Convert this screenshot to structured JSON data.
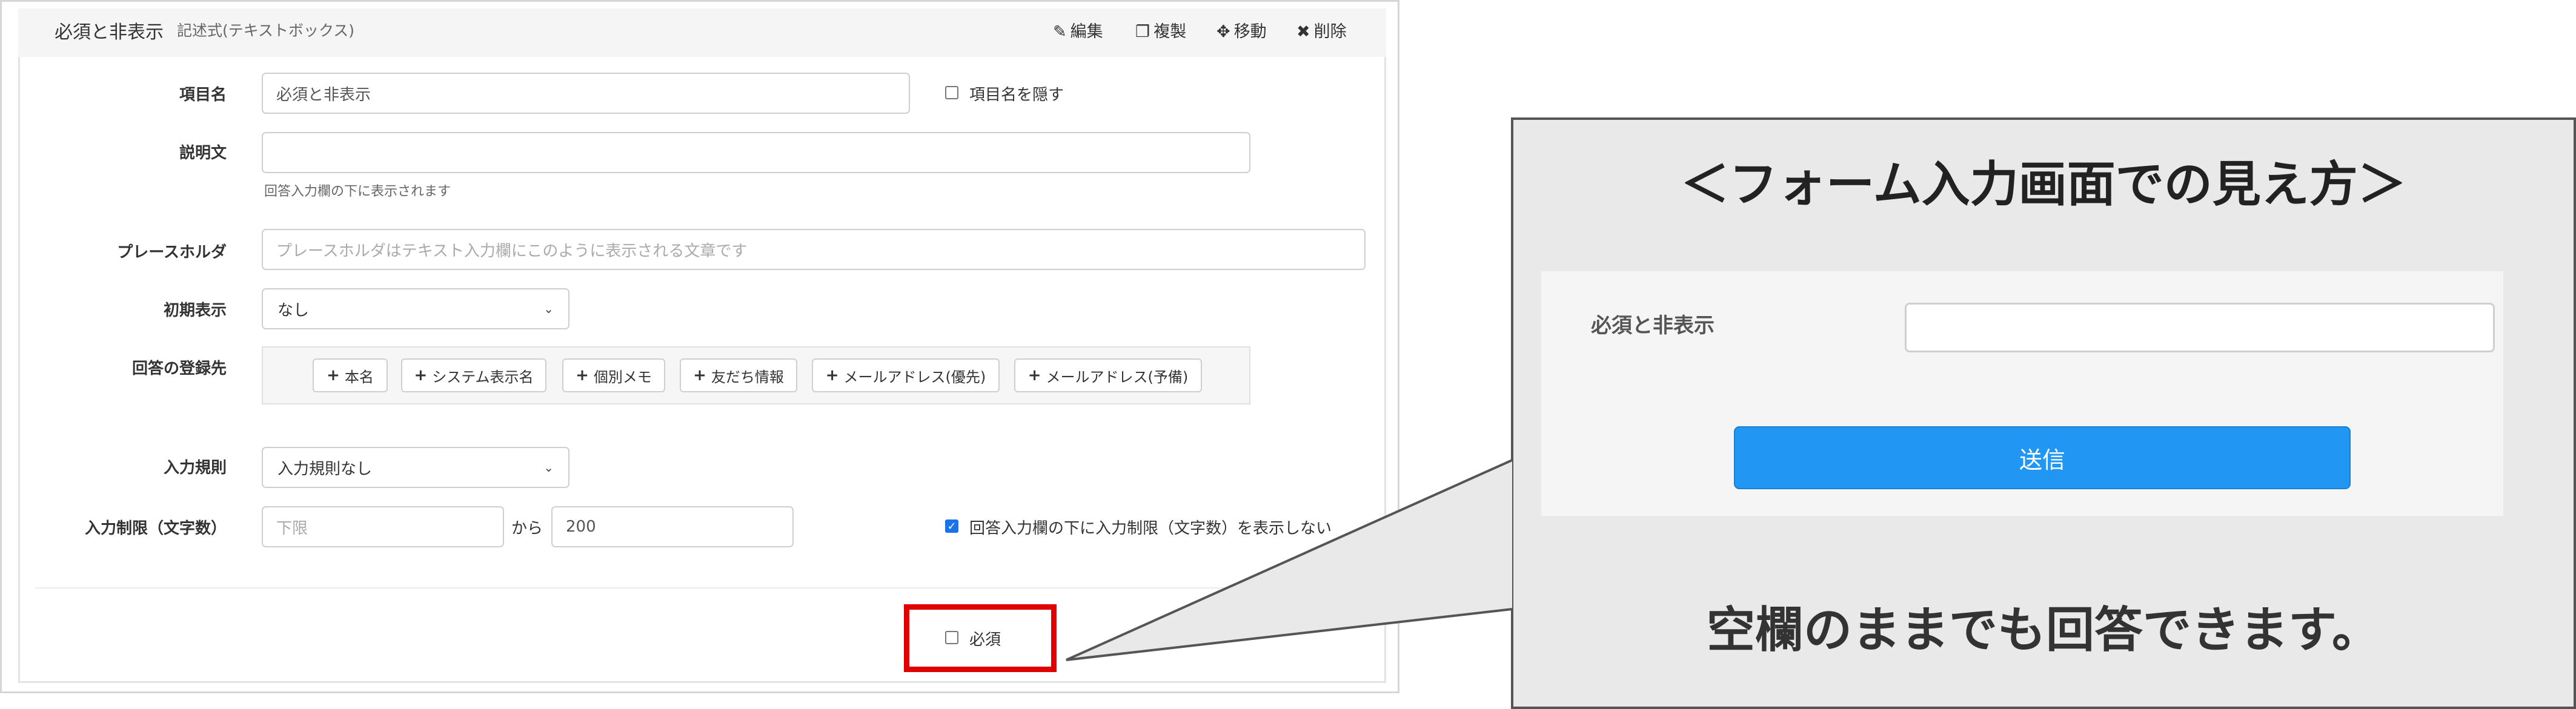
{
  "editor": {
    "header": {
      "title": "必須と非表示",
      "subtitle": "記述式(テキストボックス)",
      "actions": {
        "edit": "編集",
        "duplicate": "複製",
        "move": "移動",
        "delete": "削除"
      }
    },
    "fields": {
      "item_name": {
        "label": "項目名",
        "value": "必須と非表示",
        "hide_label": "項目名を隠す",
        "hide_checked": false
      },
      "description": {
        "label": "説明文",
        "value": "",
        "help": "回答入力欄の下に表示されます"
      },
      "placeholder": {
        "label": "プレースホルダ",
        "placeholder": "プレースホルダはテキスト入力欄にこのように表示される文章です"
      },
      "initial_display": {
        "label": "初期表示",
        "value": "なし"
      },
      "answer_destination": {
        "label": "回答の登録先",
        "buttons": [
          "本名",
          "システム表示名",
          "個別メモ",
          "友だち情報",
          "メールアドレス(優先)",
          "メールアドレス(予備)"
        ]
      },
      "input_rule": {
        "label": "入力規則",
        "value": "入力規則なし"
      },
      "input_limit": {
        "label": "入力制限（文字数）",
        "min_placeholder": "下限",
        "separator": "から",
        "max_value": "200",
        "hide_limit_label": "回答入力欄の下に入力制限（文字数）を表示しない",
        "hide_limit_checked": true
      }
    },
    "required": {
      "label": "必須",
      "checked": false
    },
    "hidden_partial": "ー"
  },
  "preview": {
    "heading": "＜フォーム入力画面での見え方＞",
    "field_label": "必須と非表示",
    "submit_label": "送信",
    "note": "空欄のままでも回答できます。"
  },
  "colors": {
    "highlight": "#e00000",
    "submit": "#2196f3",
    "checkbox_checked": "#1a73e8"
  }
}
